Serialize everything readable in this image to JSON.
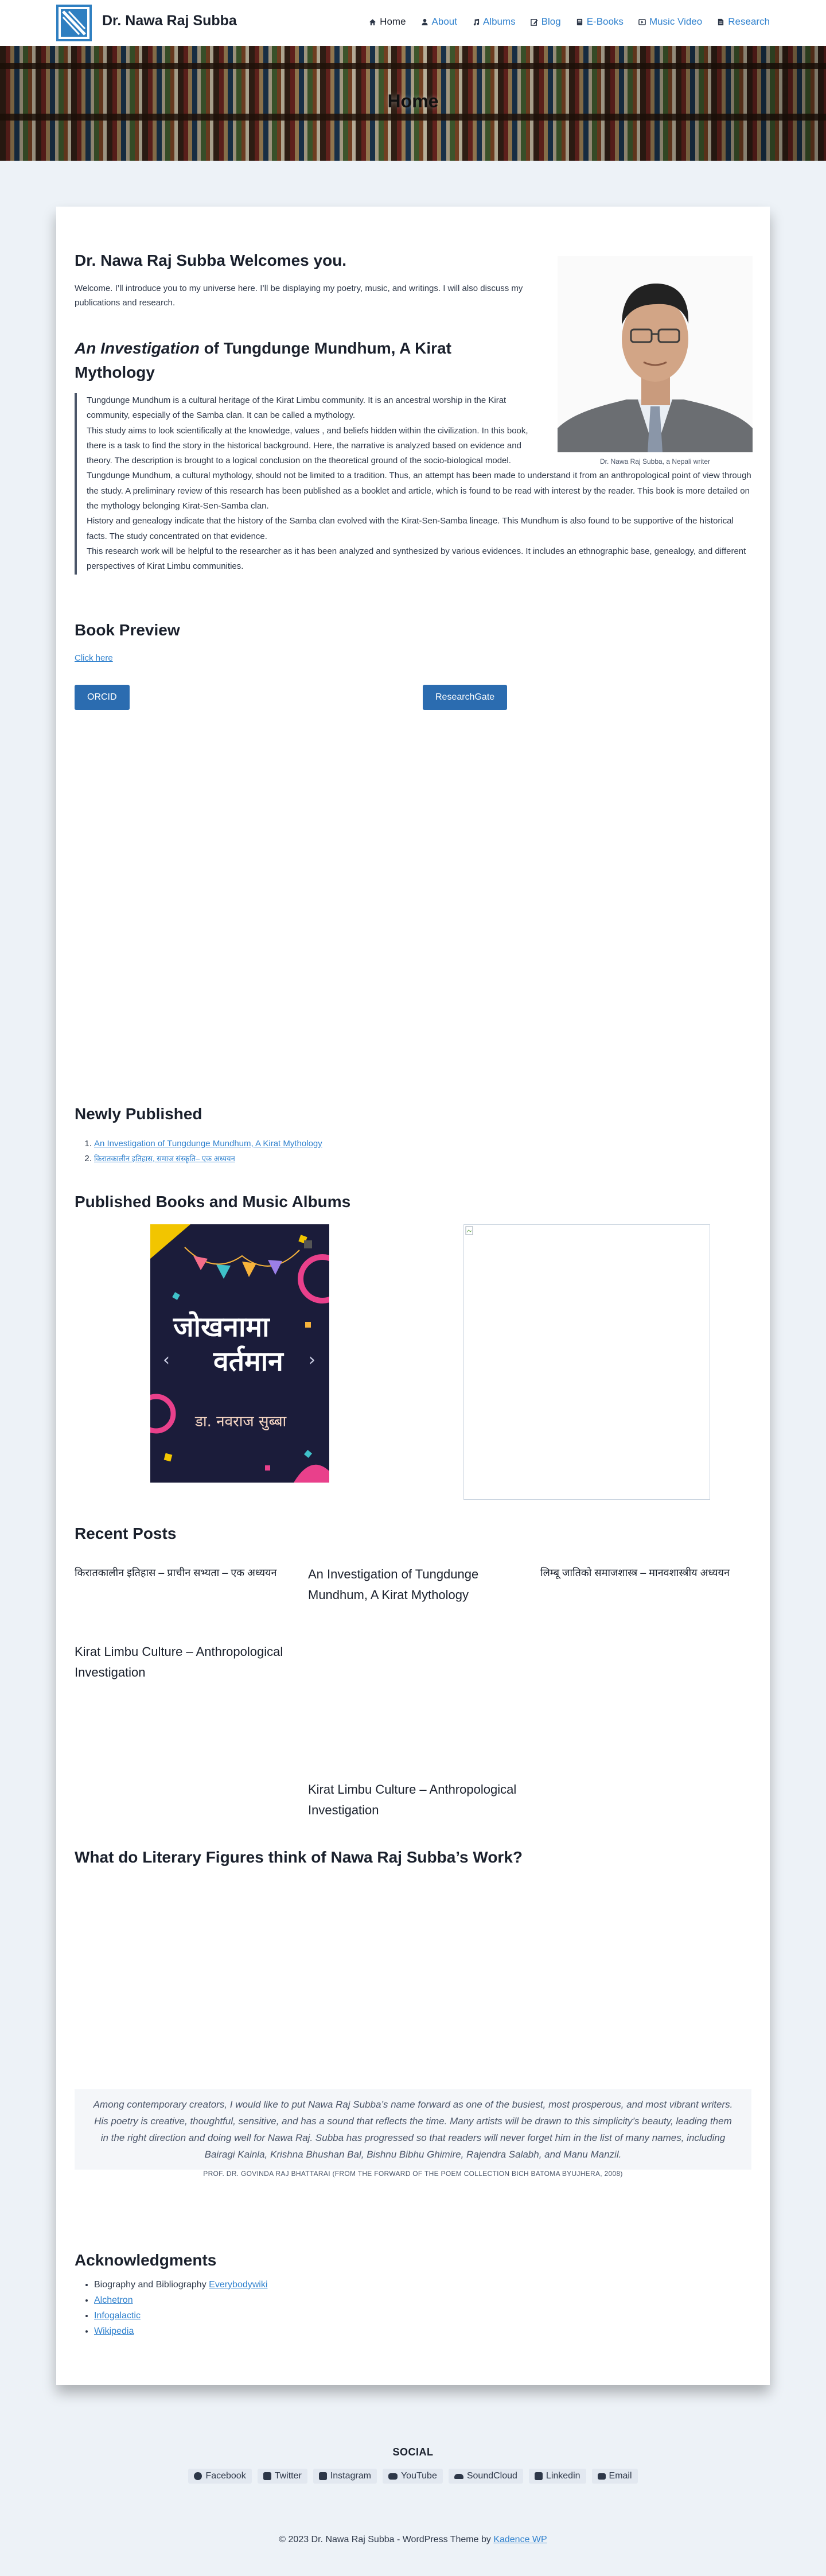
{
  "header": {
    "site_title": "Dr. Nawa Raj Subba",
    "nav": [
      {
        "label": "Home",
        "icon": "home-icon"
      },
      {
        "label": "About",
        "icon": "person-icon"
      },
      {
        "label": "Albums",
        "icon": "music-icon"
      },
      {
        "label": "Blog",
        "icon": "pen-icon"
      },
      {
        "label": "E-Books",
        "icon": "book-icon"
      },
      {
        "label": "Music Video",
        "icon": "video-icon"
      },
      {
        "label": "Research",
        "icon": "document-icon"
      }
    ]
  },
  "hero": {
    "title": "Home"
  },
  "welcome": {
    "heading": "Dr. Nawa Raj Subba Welcomes you.",
    "text": "Welcome. I’ll introduce you to my universe here. I’ll be displaying my poetry, music, and writings. I will also discuss my publications and research."
  },
  "portrait": {
    "caption": "Dr. Nawa Raj Subba, a Nepali writer"
  },
  "investigation": {
    "title_italic": "An Investigation",
    "title_rest": " of Tungdunge Mundhum, A Kirat Mythology",
    "lines": [
      "Tungdunge Mundhum is a cultural heritage of the Kirat Limbu community. It is an ancestral worship in the Kirat community, especially of the Samba clan. It can be called a mythology.",
      "This study aims to look scientifically at the knowledge, values , and beliefs hidden within the civilization. In this book, there is a task to find the story in the historical background. Here, the narrative is analyzed based on evidence and theory. The description is brought to a logical conclusion on the theoretical ground of the socio-biological model.",
      "Tungdunge Mundhum, a cultural mythology, should not be limited to a tradition. Thus, an attempt has been made to understand it from an anthropological point of view through the study. A preliminary review of this research has been published as a booklet and article, which is found to be read with interest by the reader. This book is more detailed on the mythology belonging Kirat-Sen-Samba clan.",
      "History and genealogy indicate that the history of the Samba clan evolved with the Kirat-Sen-Samba lineage. This Mundhum is also found to be supportive of the historical facts. The study concentrated on that evidence.",
      "This research work will be helpful to the researcher as it has been analyzed and synthesized by various evidences. It includes an ethnographic base, genealogy, and different perspectives of Kirat Limbu communities."
    ]
  },
  "book_preview": {
    "heading": "Book Preview",
    "link": "Click here"
  },
  "buttons": {
    "orcid": "ORCID",
    "researchgate": "ResearchGate"
  },
  "newly_published": {
    "heading": "Newly Published",
    "items": [
      "An Investigation of Tungdunge Mundhum, A Kirat Mythology",
      "किरातकालीन इतिहास, समाज संस्कृति– एक अध्ययन"
    ]
  },
  "books_albums": {
    "heading": "Published Books and Music Albums",
    "book_cover": {
      "title_line1": "जोखनामा",
      "title_line2": "वर्तमान",
      "author": "डा. नवराज सुब्बा"
    }
  },
  "recent_posts": {
    "heading": "Recent Posts",
    "posts": [
      "किरातकालीन इतिहास – प्राचीन सभ्यता – एक अध्ययन",
      "An Investigation of Tungdunge Mundhum, A Kirat Mythology",
      "लिम्बू जातिको समाजशास्त्र – मानवशास्त्रीय अध्ययन",
      "Kirat Limbu Culture – Anthropological Investigation",
      "Kirat Limbu Culture – Anthropological Investigation"
    ]
  },
  "literary": {
    "heading": "What do Literary Figures think of Nawa Raj Subba’s Work?",
    "quote": "Among contemporary creators, I would like to put Nawa Raj Subba’s name forward as one of the busiest, most prosperous, and most vibrant writers. His poetry is creative, thoughtful, sensitive, and has a sound that reflects the time. Many artists will be drawn to this simplicity’s beauty, leading them in the right direction and doing well for Nawa Raj. Subba has progressed so that readers will never forget him in the list of many names, including Bairagi Kainla, Krishna Bhushan Bal, Bishnu Bibhu Ghimire, Rajendra Salabh, and Manu Manzil.",
    "cite": "PROF. DR. GOVINDA RAJ BHATTARAI (FROM THE FORWARD OF THE POEM COLLECTION BICH BATOMA BYUJHERA, 2008)"
  },
  "acknowledgments": {
    "heading": "Acknowledgments",
    "item1_text": "Biography and Bibliography ",
    "item1_link": "Everybodywiki",
    "links": [
      "Alchetron",
      "Infogalactic",
      "Wikipedia"
    ]
  },
  "footer": {
    "social_heading": "SOCIAL",
    "social": [
      {
        "label": "Facebook",
        "icon": "facebook-icon"
      },
      {
        "label": "Twitter",
        "icon": "twitter-icon"
      },
      {
        "label": "Instagram",
        "icon": "instagram-icon"
      },
      {
        "label": "YouTube",
        "icon": "youtube-icon"
      },
      {
        "label": "SoundCloud",
        "icon": "soundcloud-icon"
      },
      {
        "label": "Linkedin",
        "icon": "linkedin-icon"
      },
      {
        "label": "Email",
        "icon": "email-icon"
      }
    ],
    "copyright_prefix": "© 2023 Dr. Nawa Raj Subba - WordPress Theme by ",
    "copyright_link": "Kadence WP"
  },
  "colors": {
    "accent": "#2b6cb0",
    "link": "#3182ce",
    "page_bg": "#edf2f7",
    "logo": "#2f7fc1"
  }
}
